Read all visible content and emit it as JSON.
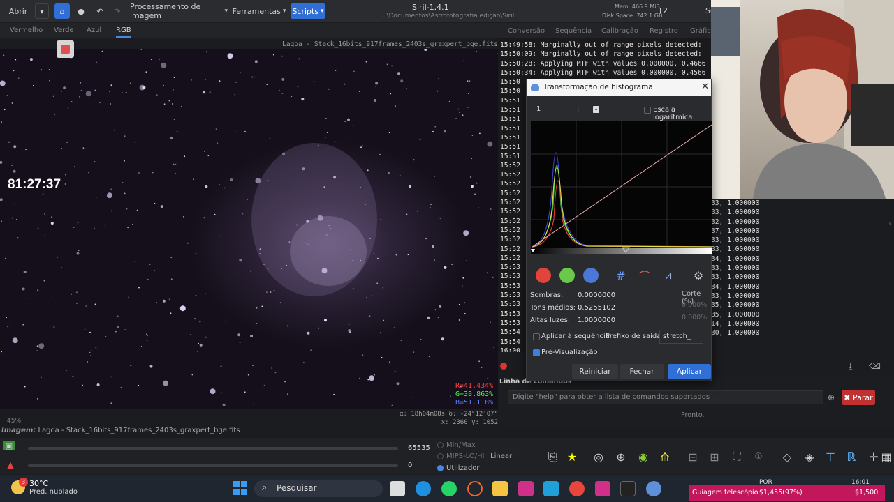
{
  "topbar": {
    "open_label": "Abrir",
    "image_processing_label": "Processamento de imagem",
    "tools_label": "Ferramentas",
    "scripts_label": "Scripts",
    "app_title": "Siril-1.4.1",
    "path": "...\\Documentos\\Astrofotografia edição\\Siril",
    "mem": "Mem: 466.9 MiB",
    "disk": "Disk Space: 742.1 GB",
    "threads": "12",
    "trailing": "Se"
  },
  "channels": {
    "red": "Vermelho",
    "green": "Verde",
    "blue": "Azul",
    "rgb": "RGB"
  },
  "image": {
    "filename": "Lagoa - Stack_16bits_917frames_2403s_graxpert_bge.fits",
    "timer": "81:27:37",
    "readout_r": "R=41.434%",
    "readout_g": "G=38.863%",
    "readout_b": "B=51.118%",
    "coord_alpha": "α: 18h04m08s δ: -24°12'07\"",
    "coord_xy": "x: 2360 y: 1052",
    "zoom": "45%",
    "status_label": "Imagem:",
    "status_value": "Lagoa - Stack_16bits_917frames_2403s_graxpert_bge.fits"
  },
  "right_tabs": [
    "Conversão",
    "Sequência",
    "Calibração",
    "Registro",
    "Gráfico"
  ],
  "log_lines": [
    "15:49:58: Marginally out of range pixels detected:",
    "15:50:09: Marginally out of range pixels detected:",
    "15:50:28: Applying MTF with values 0.000000, 0.4666",
    "15:50:34: Applying MTF with values 0.000000, 0.4566",
    "15:50",
    "15:50",
    "15:51",
    "15:51",
    "15:51",
    "15:51",
    "15:51",
    "15:51",
    "15:51",
    "15:52",
    "15:52",
    "15:52",
    "15:52",
    "15:52",
    "15:52",
    "15:52",
    "15:52",
    "15:52",
    "15:52",
    "15:52",
    "15:53",
    "15:53",
    "15:53",
    "15:53",
    "15:53",
    "15:53",
    "15:53",
    "15:54",
    "15:54",
    "16:00",
    "16:00"
  ],
  "log_tail": [
    "33, 1.000000",
    "33, 1.000000",
    "32, 1.000000",
    "37, 1.000000",
    "33, 1.000000",
    "33, 1.000000",
    "34, 1.000000",
    "33, 1.000000",
    "33, 1.000000",
    "34, 1.000000",
    "33, 1.000000",
    "35, 1.000000",
    "35, 1.000000",
    "14, 1.000000",
    "30, 1.000000"
  ],
  "command": {
    "section_label": "Linha de comandos",
    "placeholder": "Digite \"help\" para obter a lista de comandos suportados",
    "stop_label": "Parar",
    "status": "Pronto."
  },
  "dialog": {
    "title": "Transformação de histograma",
    "zoom_value": "1",
    "log_scale_label": "Escala logarítmica",
    "shadows_label": "Sombras:",
    "shadows_value": "0.0000000",
    "midtones_label": "Tons médios:",
    "midtones_value": "0.5255102",
    "highlights_label": "Altas luzes:",
    "highlights_value": "1.0000000",
    "clip_label": "Corte (%)",
    "clip_low": "0.000%",
    "clip_high": "0.000%",
    "apply_seq_label": "Aplicar à sequência",
    "prefix_label": "Prefixo de saída:",
    "prefix_value": "stretch_",
    "preview_label": "Pré-Visualização",
    "reset_label": "Reiniciar",
    "close_label": "Fechar",
    "apply_label": "Aplicar"
  },
  "bottom": {
    "max_value": "65535",
    "min_value": "0",
    "mode_minmax": "Min/Max",
    "mode_mips": "MIPS-LO/HI",
    "mode_user": "Utilizador",
    "scale_mode": "Linear"
  },
  "taskbar": {
    "temp": "30°C",
    "weather": "Pred. nublado",
    "badge": "3",
    "search": "Pesquisar",
    "lang": "POR",
    "time": "16:01",
    "guide_label": "Guiagem telescópio",
    "guide_progress": "$1,455(97%)",
    "guide_goal": "$1,500"
  },
  "colors": {
    "accent": "#2f6fd6",
    "stop": "#c23131",
    "guide": "#c2185b"
  }
}
